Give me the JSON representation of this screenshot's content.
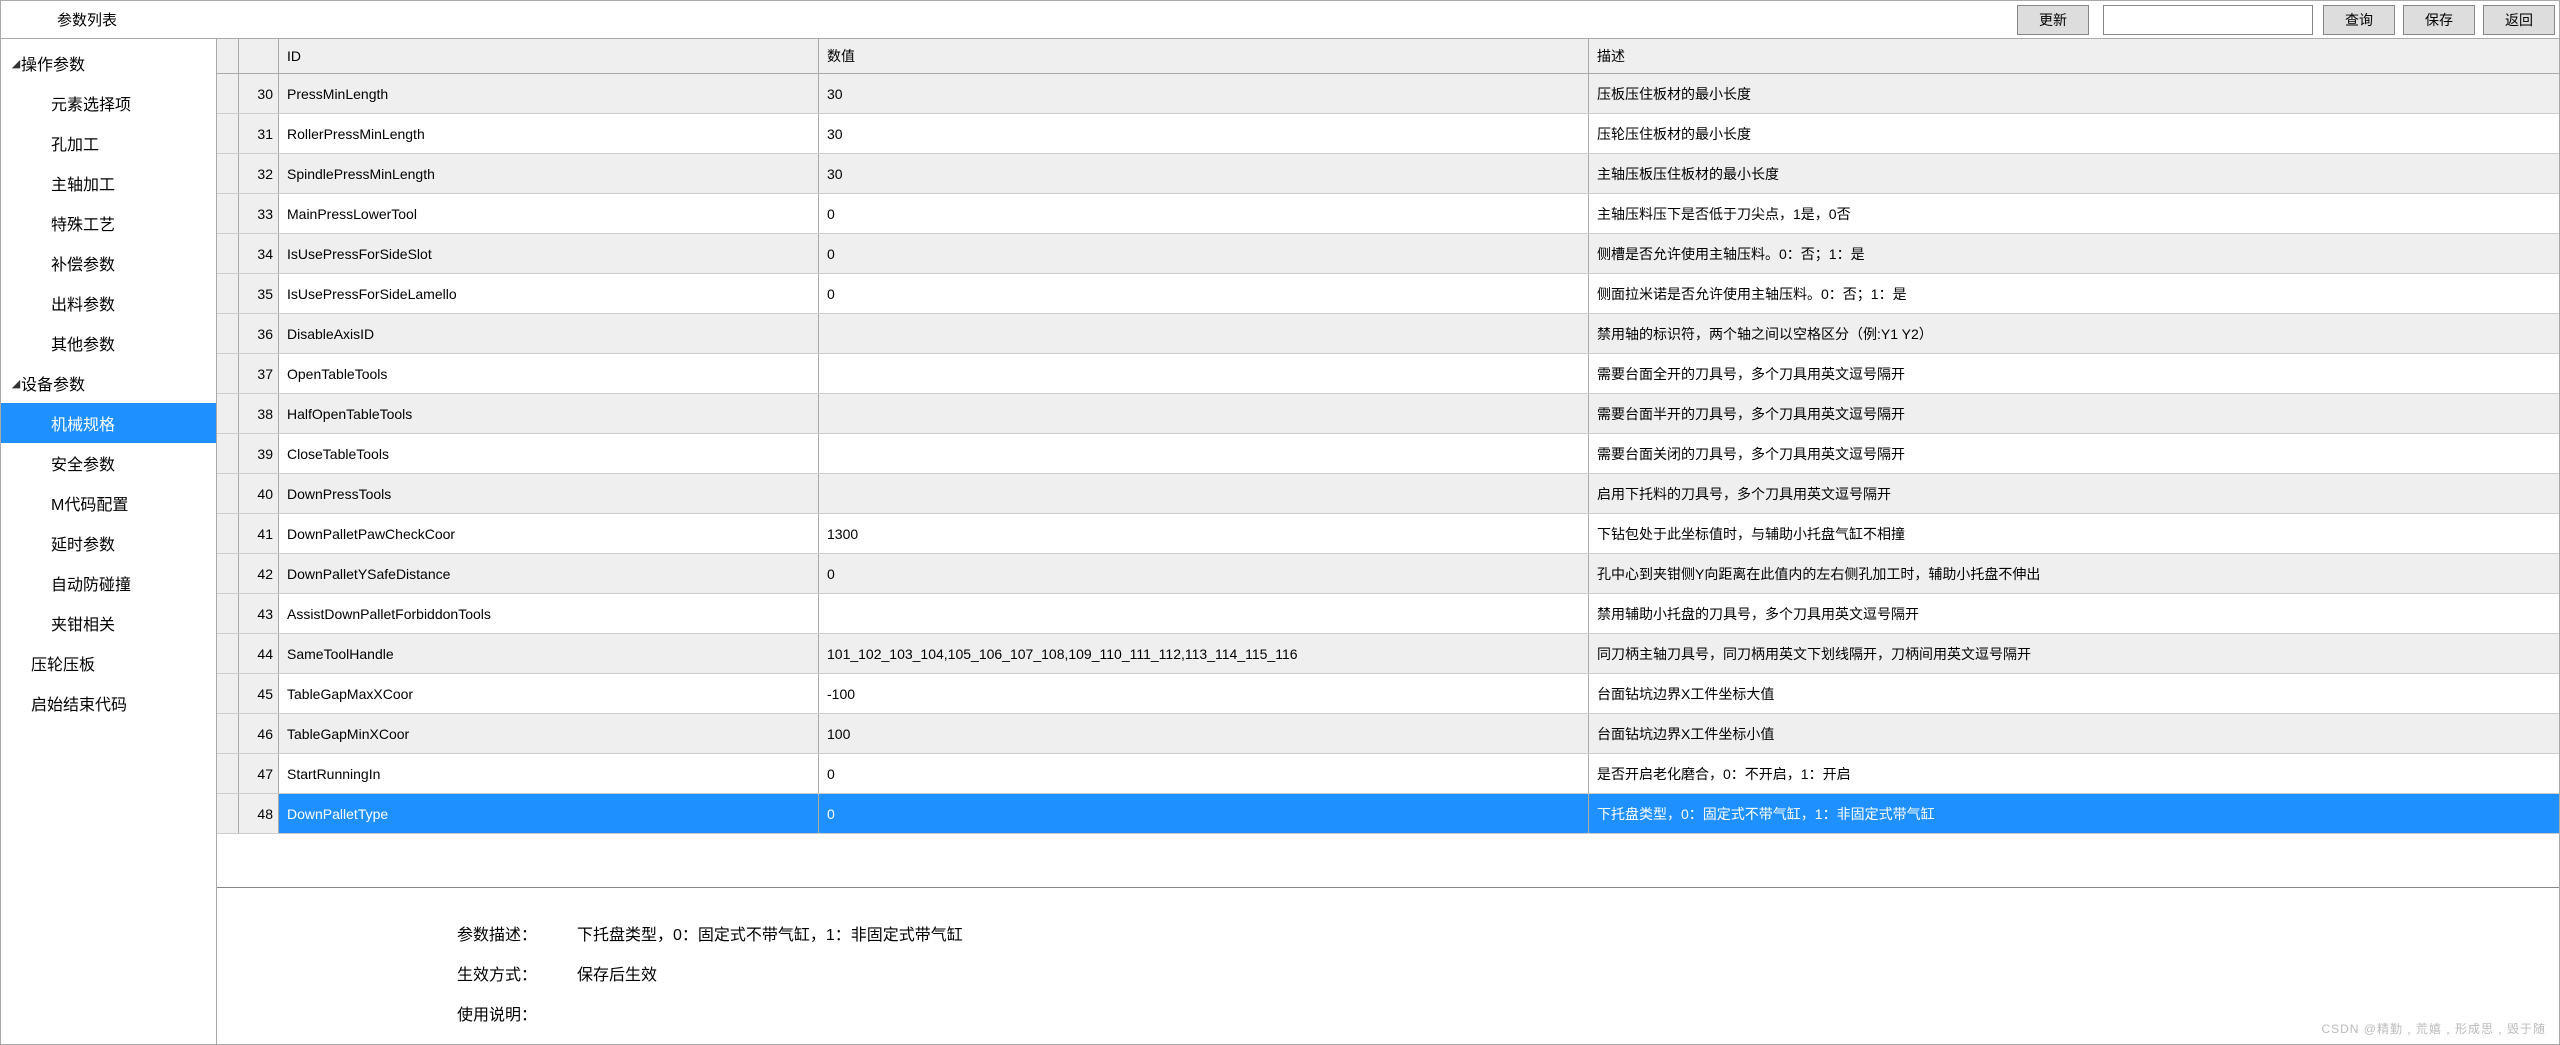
{
  "header": {
    "title": "参数列表",
    "update_label": "更新",
    "query_label": "查询",
    "save_label": "保存",
    "back_label": "返回",
    "search_value": ""
  },
  "sidebar": {
    "group1": {
      "label": "操作参数",
      "expanded": true
    },
    "items1": [
      {
        "label": "元素选择项"
      },
      {
        "label": "孔加工"
      },
      {
        "label": "主轴加工"
      },
      {
        "label": "特殊工艺"
      },
      {
        "label": "补偿参数"
      },
      {
        "label": "出料参数"
      },
      {
        "label": "其他参数"
      }
    ],
    "group2": {
      "label": "设备参数",
      "expanded": true
    },
    "items2": [
      {
        "label": "机械规格",
        "selected": true
      },
      {
        "label": "安全参数"
      },
      {
        "label": "M代码配置"
      },
      {
        "label": "延时参数"
      },
      {
        "label": "自动防碰撞"
      },
      {
        "label": "夹钳相关"
      }
    ],
    "items3": [
      {
        "label": "压轮压板"
      },
      {
        "label": "启始结束代码"
      }
    ],
    "selected_label": "机械规格"
  },
  "grid": {
    "headers": {
      "id": "ID",
      "value": "数值",
      "desc": "描述"
    },
    "rows": [
      {
        "n": "30",
        "id": "PressMinLength",
        "value": "30",
        "desc": "压板压住板材的最小长度"
      },
      {
        "n": "31",
        "id": "RollerPressMinLength",
        "value": "30",
        "desc": "压轮压住板材的最小长度"
      },
      {
        "n": "32",
        "id": "SpindlePressMinLength",
        "value": "30",
        "desc": "主轴压板压住板材的最小长度"
      },
      {
        "n": "33",
        "id": "MainPressLowerTool",
        "value": "0",
        "desc": "主轴压料压下是否低于刀尖点，1是，0否"
      },
      {
        "n": "34",
        "id": "IsUsePressForSideSlot",
        "value": "0",
        "desc": "侧槽是否允许使用主轴压料。0：否；1：是"
      },
      {
        "n": "35",
        "id": "IsUsePressForSideLamello",
        "value": "0",
        "desc": "侧面拉米诺是否允许使用主轴压料。0：否；1：是"
      },
      {
        "n": "36",
        "id": "DisableAxisID",
        "value": "",
        "desc": "禁用轴的标识符，两个轴之间以空格区分（例:Y1 Y2）"
      },
      {
        "n": "37",
        "id": "OpenTableTools",
        "value": "",
        "desc": "需要台面全开的刀具号，多个刀具用英文逗号隔开"
      },
      {
        "n": "38",
        "id": "HalfOpenTableTools",
        "value": "",
        "desc": "需要台面半开的刀具号，多个刀具用英文逗号隔开"
      },
      {
        "n": "39",
        "id": "CloseTableTools",
        "value": "",
        "desc": "需要台面关闭的刀具号，多个刀具用英文逗号隔开"
      },
      {
        "n": "40",
        "id": "DownPressTools",
        "value": "",
        "desc": "启用下托料的刀具号，多个刀具用英文逗号隔开"
      },
      {
        "n": "41",
        "id": "DownPalletPawCheckCoor",
        "value": "1300",
        "desc": "下钻包处于此坐标值时，与辅助小托盘气缸不相撞"
      },
      {
        "n": "42",
        "id": "DownPalletYSafeDistance",
        "value": "0",
        "desc": " 孔中心到夹钳侧Y向距离在此值内的左右侧孔加工时，辅助小托盘不伸出"
      },
      {
        "n": "43",
        "id": "AssistDownPalletForbiddonTools",
        "value": "",
        "desc": "禁用辅助小托盘的刀具号，多个刀具用英文逗号隔开"
      },
      {
        "n": "44",
        "id": "SameToolHandle",
        "value": "101_102_103_104,105_106_107_108,109_110_111_112,113_114_115_116",
        "desc": "同刀柄主轴刀具号，同刀柄用英文下划线隔开，刀柄间用英文逗号隔开"
      },
      {
        "n": "45",
        "id": "TableGapMaxXCoor",
        "value": "-100",
        "desc": "台面钻坑边界X工件坐标大值"
      },
      {
        "n": "46",
        "id": "TableGapMinXCoor",
        "value": "100",
        "desc": "台面钻坑边界X工件坐标小值"
      },
      {
        "n": "47",
        "id": "StartRunningIn",
        "value": "0",
        "desc": "是否开启老化磨合，0：不开启，1：开启"
      },
      {
        "n": "48",
        "id": "DownPalletType",
        "value": "0",
        "desc": "下托盘类型，0：固定式不带气缸，1：非固定式带气缸",
        "selected": true
      }
    ]
  },
  "detail": {
    "label_desc": "参数描述：",
    "label_effect": "生效方式：",
    "label_usage": "使用说明：",
    "value_desc": "下托盘类型，0：固定式不带气缸，1：非固定式带气缸",
    "value_effect": "保存后生效",
    "value_usage": ""
  },
  "watermark": "CSDN @精勤﹐荒嬉﹐形成思﹐毁于随"
}
